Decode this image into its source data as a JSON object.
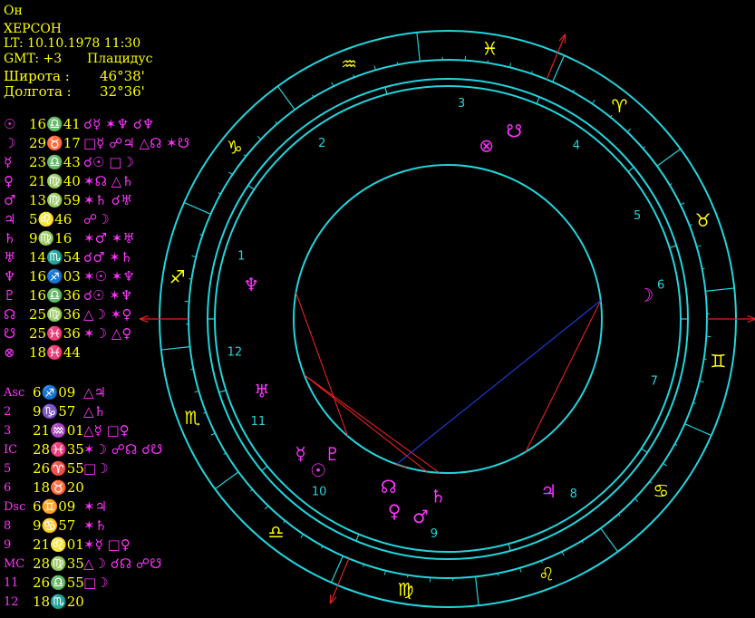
{
  "header": {
    "name": "Он",
    "city": "ХЕРСОН",
    "local_time": "LT: 10.10.1978  11:30",
    "gmt": "GMT: +3",
    "system": "Плацидус",
    "lat_label": "Широта :",
    "lat_value": "46°38'",
    "lon_label": "Долгота :",
    "lon_value": "32°36'"
  },
  "planets": [
    {
      "symbol": "☉",
      "value": "16♎41",
      "aspects": "☌☿ ✶♆ ☌♆"
    },
    {
      "symbol": "☽",
      "value": "29♉17",
      "aspects": "□☿ ☍♃ △☊ ✶☋"
    },
    {
      "symbol": "☿",
      "value": "23♎43",
      "aspects": "☌☉ □☽"
    },
    {
      "symbol": "♀",
      "value": "21♍40",
      "aspects": "✶☊ △♄"
    },
    {
      "symbol": "♂",
      "value": "13♍59",
      "aspects": "✶♄ ☌♅"
    },
    {
      "symbol": "♃",
      "value": "5♌46",
      "aspects": "☍☽"
    },
    {
      "symbol": "♄",
      "value": "9♍16",
      "aspects": "✶♂ ✶♅"
    },
    {
      "symbol": "♅",
      "value": "14♏54",
      "aspects": "☌♂ ✶♄"
    },
    {
      "symbol": "♆",
      "value": "16♐03",
      "aspects": "✶☉ ✶♆"
    },
    {
      "symbol": "♇",
      "value": "16♎36",
      "aspects": "☌☉ ✶♆"
    },
    {
      "symbol": "☊",
      "value": "25♍36",
      "aspects": "△☽ ✶♀"
    },
    {
      "symbol": "☋",
      "value": "25♓36",
      "aspects": "✶☽ △♀"
    },
    {
      "symbol": "⊗",
      "value": "18♓44",
      "aspects": ""
    }
  ],
  "houses": [
    {
      "label": "Asc",
      "value": "6♐09",
      "aspects": "△♃"
    },
    {
      "label": "2",
      "value": "9♑57",
      "aspects": "△♄"
    },
    {
      "label": "3",
      "value": "21♒01",
      "aspects": "△☿ □♀"
    },
    {
      "label": "IC",
      "value": "28♓35",
      "aspects": "✶☽ ☍☊ ☌☋"
    },
    {
      "label": "5",
      "value": "26♈55",
      "aspects": "□☽"
    },
    {
      "label": "6",
      "value": "18♉20",
      "aspects": ""
    },
    {
      "label": "Dsc",
      "value": "6♊09",
      "aspects": "✶♃"
    },
    {
      "label": "8",
      "value": "9♋57",
      "aspects": "✶♄"
    },
    {
      "label": "9",
      "value": "21♌01",
      "aspects": "✶☿ □♀"
    },
    {
      "label": "MC",
      "value": "28♍35",
      "aspects": "△☽ ☌☊ ☍☋"
    },
    {
      "label": "11",
      "value": "26♎55",
      "aspects": "□☽"
    },
    {
      "label": "12",
      "value": "18♏20",
      "aspects": ""
    }
  ],
  "wheel": {
    "signs": [
      "♈",
      "♉",
      "♊",
      "♋",
      "♌",
      "♍",
      "♎",
      "♏",
      "♐",
      "♑",
      "♒",
      "♓"
    ],
    "house_numbers": [
      "1",
      "2",
      "3",
      "4",
      "5",
      "6",
      "7",
      "8",
      "9",
      "10",
      "11",
      "12"
    ],
    "chart_planets": [
      {
        "glyph": "☉",
        "lon": 196.68,
        "color": "#ff33ff"
      },
      {
        "glyph": "☽",
        "lon": 59.28,
        "color": "#ff33ff"
      },
      {
        "glyph": "☿",
        "lon": 203.72,
        "color": "#ff33ff"
      },
      {
        "glyph": "♀",
        "lon": 171.67,
        "color": "#ff33ff"
      },
      {
        "glyph": "♂",
        "lon": 163.98,
        "color": "#ff33ff"
      },
      {
        "glyph": "♃",
        "lon": 125.77,
        "color": "#ff33ff"
      },
      {
        "glyph": "♄",
        "lon": 159.27,
        "color": "#ff33ff"
      },
      {
        "glyph": "♅",
        "lon": 224.9,
        "color": "#ff33ff"
      },
      {
        "glyph": "♆",
        "lon": 256.05,
        "color": "#ff33ff"
      },
      {
        "glyph": "♇",
        "lon": 196.6,
        "color": "#ff33ff"
      },
      {
        "glyph": "☊",
        "lon": 175.6,
        "color": "#ff33ff"
      },
      {
        "glyph": "☋",
        "lon": 355.6,
        "color": "#ff33ff"
      },
      {
        "glyph": "⊗",
        "lon": 348.73,
        "color": "#ff33ff"
      }
    ],
    "house_cusps": [
      246.15,
      279.95,
      321.02,
      358.58,
      26.92,
      48.33,
      66.15,
      99.95,
      141.02,
      178.58,
      206.92,
      228.33
    ],
    "aspects": [
      {
        "from": 59.28,
        "to": 125.77,
        "color": "#ff2222"
      },
      {
        "from": 59.28,
        "to": 175.6,
        "color": "#2244ff"
      },
      {
        "from": 159.27,
        "to": 224.9,
        "color": "#ff2222"
      },
      {
        "from": 163.98,
        "to": 224.9,
        "color": "#ff2222"
      },
      {
        "from": 196.6,
        "to": 256.05,
        "color": "#ff2222"
      },
      {
        "from": 171.67,
        "to": 175.6,
        "color": "#ff2222"
      }
    ],
    "colors": {
      "ring": "#22d4dd",
      "text": "#ffff00",
      "planet": "#ff33ff",
      "house": "#22d4dd",
      "axis": "#dd2222"
    }
  }
}
